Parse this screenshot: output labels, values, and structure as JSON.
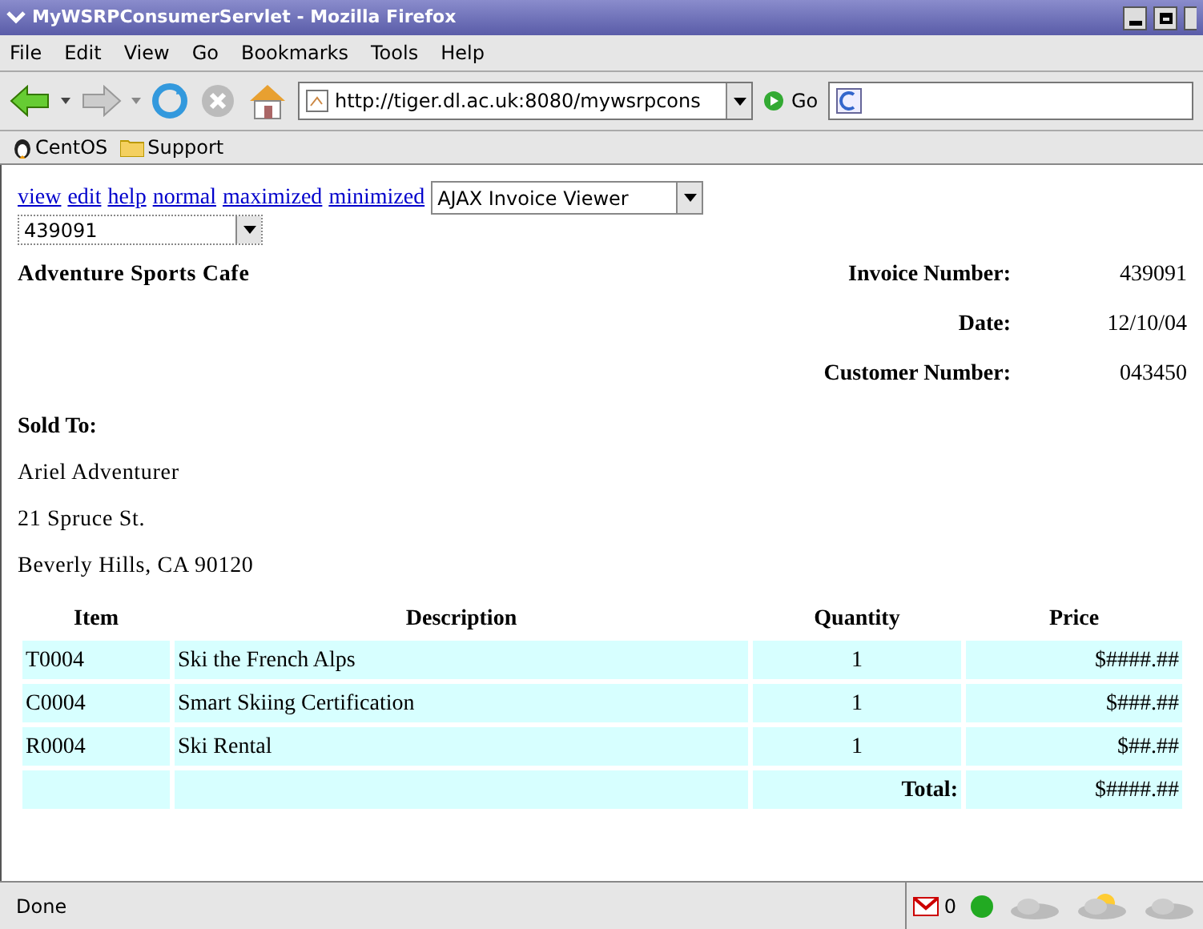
{
  "window": {
    "title": "MyWSRPConsumerServlet - Mozilla Firefox"
  },
  "menu": [
    "File",
    "Edit",
    "View",
    "Go",
    "Bookmarks",
    "Tools",
    "Help"
  ],
  "toolbar": {
    "url": "http://tiger.dl.ac.uk:8080/mywsrpcons",
    "go": "Go"
  },
  "bookmarks": [
    "CentOS",
    "Support"
  ],
  "portlet_links": [
    "view",
    "edit",
    "help",
    "normal",
    "maximized",
    "minimized"
  ],
  "portlet_select": "AJAX Invoice Viewer",
  "invoice_select": "439091",
  "company": "Adventure Sports Cafe",
  "fields": [
    {
      "label": "Invoice Number:",
      "value": "439091"
    },
    {
      "label": "Date:",
      "value": "12/10/04"
    },
    {
      "label": "Customer Number:",
      "value": "043450"
    }
  ],
  "sold_to": {
    "heading": "Sold To:",
    "lines": [
      "Ariel Adventurer",
      "21 Spruce St.",
      "Beverly Hills, CA 90120"
    ]
  },
  "table": {
    "columns": [
      "Item",
      "Description",
      "Quantity",
      "Price"
    ],
    "rows": [
      [
        "T0004",
        "Ski the French Alps",
        "1",
        "$####.##"
      ],
      [
        "C0004",
        "Smart Skiing Certification",
        "1",
        "$###.##"
      ],
      [
        "R0004",
        "Ski Rental",
        "1",
        "$##.##"
      ]
    ],
    "total": {
      "label": "Total:",
      "value": "$####.##"
    }
  },
  "status_bar": {
    "text": "Done",
    "mail_count": "0"
  }
}
